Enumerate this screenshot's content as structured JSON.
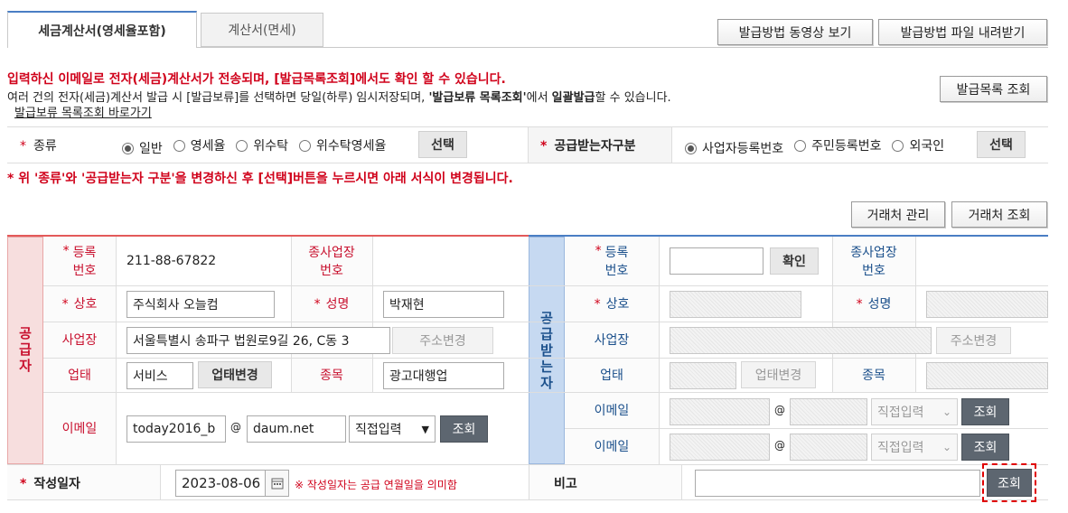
{
  "tabs": [
    {
      "label": "세금계산서(영세율포함)"
    },
    {
      "label": "계산서(면세)"
    }
  ],
  "top_buttons": {
    "video": "발급방법 동영상 보기",
    "file": "발급방법 파일 내려받기"
  },
  "notice": {
    "line1": "입력하신 이메일로 전자(세금)계산서가 전송되며, [발급목록조회]에서도 확인 할 수 있습니다.",
    "line2_a": "여러 건의 전자(세금)계산서 발급 시 [발급보류]를 선택하면 당일(하루) 임시저장되며, ",
    "line2_b": "'발급보류 목록조회'",
    "line2_c": "에서 ",
    "line2_d": "일괄발급",
    "line2_e": "할 수 있습니다.",
    "link": "발급보류 목록조회 바로가기",
    "list_button": "발급목록 조회"
  },
  "type_row": {
    "label": "종류",
    "options": [
      "일반",
      "영세율",
      "위수탁",
      "위수탁영세율"
    ],
    "selected": "일반",
    "select_button": "선택",
    "recv_label": "공급받는자구분",
    "recv_options": [
      "사업자등록번호",
      "주민등록번호",
      "외국인"
    ],
    "recv_selected": "사업자등록번호",
    "recv_select_button": "선택"
  },
  "warning": "* 위 '종류'와 '공급받는자 구분'을 변경하신 후 [선택]버튼을 누르시면 아래 서식이 변경됩니다.",
  "client_buttons": {
    "manage": "거래처 관리",
    "search": "거래처 조회"
  },
  "supplier": {
    "side_label": "공급자",
    "reg_label": "등록\n번호",
    "reg_value": "211-88-67822",
    "sub_label": "종사업장\n번호",
    "name_label": "상호",
    "name_value": "주식회사 오늘컴",
    "rep_label": "성명",
    "rep_value": "박재현",
    "addr_label": "사업장",
    "addr_value": "서울특별시 송파구 법원로9길 26, C동 3",
    "addr_button": "주소변경",
    "biz_label": "업태",
    "biz_value": "서비스",
    "biz_button": "업태변경",
    "item_label": "종목",
    "item_value": "광고대행업",
    "email_label": "이메일",
    "email_id": "today2016_b",
    "email_at": "@",
    "email_domain": "daum.net",
    "email_select": "직접입력",
    "email_button": "조회"
  },
  "receiver": {
    "side_label": "공급받는자",
    "reg_label": "등록\n번호",
    "confirm_button": "확인",
    "sub_label": "종사업장\n번호",
    "name_label": "상호",
    "rep_label": "성명",
    "addr_label": "사업장",
    "addr_button": "주소변경",
    "biz_label": "업태",
    "biz_button": "업태변경",
    "item_label": "종목",
    "email_label1": "이메일",
    "email_label2": "이메일",
    "email_at": "@",
    "email_select": "직접입력",
    "email_button": "조회"
  },
  "date_row": {
    "label": "작성일자",
    "value": "2023-08-06",
    "note": "※ 작성일자는 공급 연월일을 의미함",
    "memo_label": "비고",
    "memo_button": "조회"
  },
  "colors": {
    "supplier_side": "#f7dede",
    "receiver_side": "#c6d9f1",
    "accent": "#4a7ec4",
    "red": "#d0021b"
  }
}
